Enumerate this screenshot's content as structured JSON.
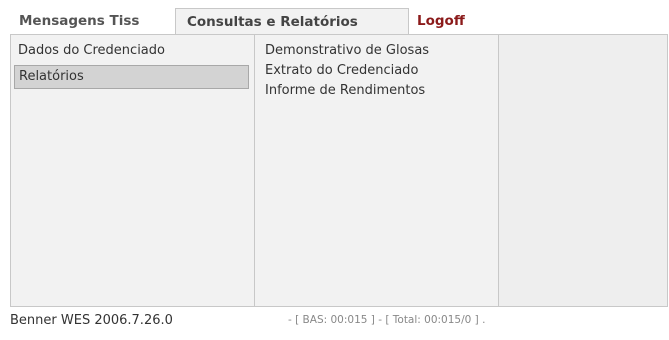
{
  "tabs": {
    "mensagens": "Mensagens Tiss",
    "consultas": "Consultas e Relatórios",
    "logoff": "Logoff"
  },
  "menu": {
    "left_items": [
      {
        "label": "Dados do Credenciado"
      },
      {
        "label": "Relatórios",
        "selected": true
      }
    ],
    "right_items": [
      {
        "label": "Demonstrativo de Glosas"
      },
      {
        "label": "Extrato do Credenciado"
      },
      {
        "label": "Informe de Rendimentos"
      }
    ]
  },
  "footer": {
    "version": "Benner WES 2006.7.26.0",
    "stats": "- [ BAS: 00:015 ] - [ Total: 00:015/0 ] ."
  },
  "colors": {
    "logoff": "#8b1a1a",
    "selected_bg": "#d3d3d3",
    "panel_bg": "#f2f2f2"
  }
}
